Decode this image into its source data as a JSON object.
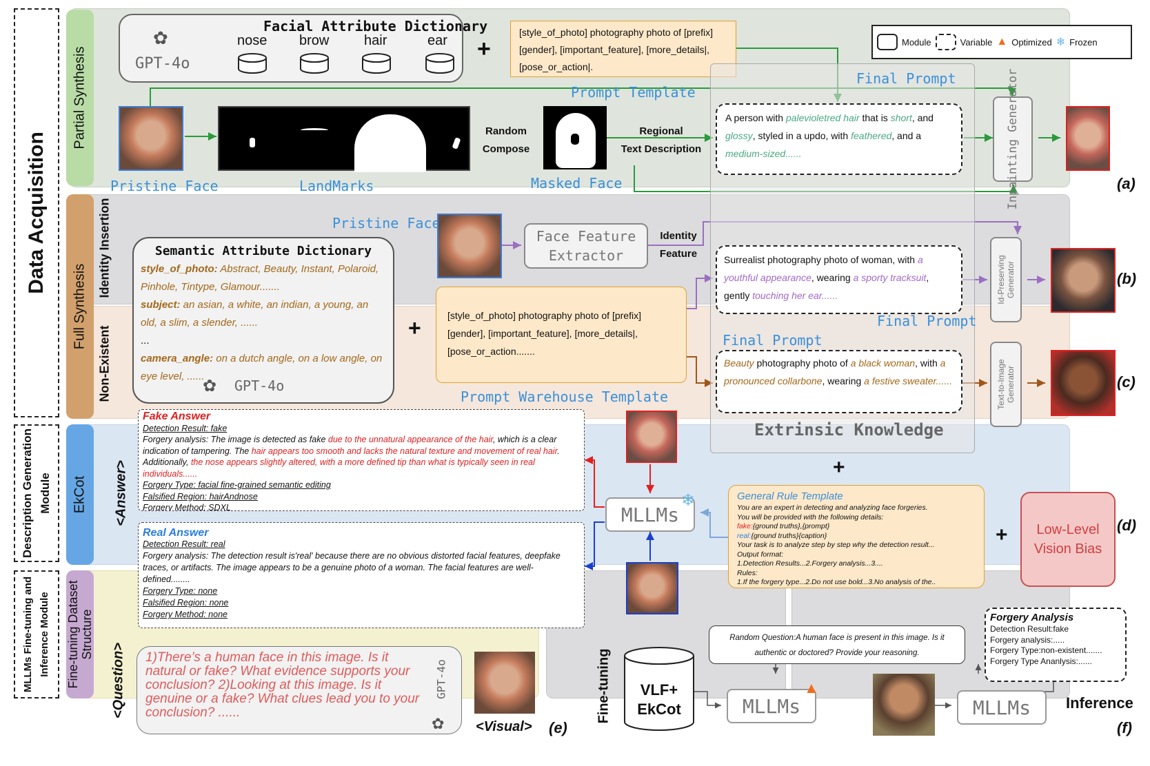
{
  "left": {
    "data_acquisition": "Data Acquisition",
    "description_module": "Description Generation Module",
    "finetune_module": "MLLMs Fine-tuning and Inference Module"
  },
  "rows": {
    "partial": "Partial Synthesis",
    "full": "Full Synthesis",
    "identity": "Identity Insertion",
    "nonexistent": "Non-Existent",
    "ekcot": "EkCot",
    "dataset": "Fine-tuning Dataset Structure"
  },
  "legend": {
    "module": "Module",
    "variable": "Variable",
    "optimized": "Optimized",
    "frozen": "Frozen"
  },
  "partial": {
    "dict_title": "Facial Attribute Dictionary",
    "gpt": "GPT-4o",
    "attrs": [
      "nose",
      "brow",
      "hair",
      "ear"
    ],
    "template": "[style_of_photo] photography photo of [prefix] [gender], [important_feature], [more_details|, [pose_or_action|.",
    "template_label": "Prompt Template",
    "final_prompt_label": "Final Prompt",
    "final_prompt": {
      "p1": "A person with ",
      "h1": "palevioletred hair",
      "p2": " that is ",
      "h2": "short",
      "p3": ", and ",
      "h3": "glossy",
      "p4": ", styled in a updo, with ",
      "h4": "feathered",
      "p5": ", and a ",
      "h5": "medium-sized......"
    },
    "pristine": "Pristine Face",
    "landmarks": "LandMarks",
    "random_compose_1": "Random",
    "random_compose_2": "Compose",
    "masked": "Masked Face",
    "regional_1": "Regional",
    "regional_2": "Text Description",
    "generator": "Inpainting Generator",
    "tag": "(a)"
  },
  "identity": {
    "pristine": "Pristine Face",
    "extractor_1": "Face Feature",
    "extractor_2": "Extractor",
    "feature_1": "Identity",
    "feature_2": "Feature",
    "final_prompt": {
      "p1": "Surrealist photography photo of woman, with ",
      "h1": "a youthful appearance",
      "p2": ", wearing ",
      "h2": "a sporty tracksuit",
      "p3": ", gently ",
      "h3": "touching her ear......"
    },
    "final_prompt_label": "Final Prompt",
    "generator": "Id-Preserving Generator",
    "tag": "(b)"
  },
  "semantic": {
    "title": "Semantic Attribute Dictionary",
    "k1": "style_of_photo:",
    "v1": " Abstract, Beauty, Instant, Polaroid, Pinhole, Tintype, Glamour.......",
    "k2": "subject:",
    "v2": " an asian, a white, an indian, a young, an old, a slim, a slender, ......",
    "ellipsis": "...",
    "k3": "camera_angle:",
    "v3": " on a dutch angle, on a low angle, on eye level, ......",
    "gpt": "GPT-4o"
  },
  "warehouse": {
    "text": "[style_of_photo] photography photo of [prefix] [gender], [important_feature], [more_details|, [pose_or_action.......",
    "label": "Prompt Warehouse Template"
  },
  "nonexistent": {
    "final_prompt_label": "Final Prompt",
    "final_prompt": {
      "h1": "Beauty",
      "p1": " photography photo of ",
      "h2": "a black woman",
      "p2": ", with ",
      "h3": "a pronounced collarbone",
      "p3": ", wearing ",
      "h4": "a festive sweater......"
    },
    "extrinsic": "Extrinsic Knowledge",
    "generator": "Text-to-Image Generator",
    "tag": "(c)"
  },
  "description": {
    "answer_tag": "<Answer>",
    "fake_title": "Fake Answer",
    "fake_result": "Detection Result: fake",
    "fake_a1": "Forgery analysis: The image is detected as fake ",
    "fake_r1": "due to the unnatural appearance of the hair",
    "fake_a2": ", which is a clear indication of tampering. The ",
    "fake_r2": "hair appears too smooth and lacks the natural texture and movement of real hair",
    "fake_a3": ". Additionally, ",
    "fake_r3": "the nose appears slightly altered, with a more defined tip than what is typically seen in real individuals......",
    "fake_type": "Forgery Type: facial fine-grained semantic editing",
    "fake_region": "Falsified Region: hairAndnose",
    "fake_method": "Forgery Method: SDXL",
    "real_title": "Real Answer",
    "real_result": "Detection Result: real",
    "real_analysis": "Forgery analysis: The detection result is'real' because there are no obvious distorted facial features, deepfake traces, or artifacts. The image appears to be a genuine photo of a woman. The facial features are well-defined........",
    "real_type": "Forgery Type: none",
    "real_region": "Falsified Region: none",
    "real_method": "Forgery Method: none",
    "mllms": "MLLMs",
    "rule_title": "General Rule Template",
    "rule_1": "You are an expert in detecting and analyzing face forgeries.",
    "rule_2": "You will be provided with the following details:",
    "rule_3k": "fake:",
    "rule_3v": "{ground truths},{prompt}",
    "rule_4k": "real:",
    "rule_4v": "{ground truths}{caption}",
    "rule_5": "Your task is to analyze step by step why the detection result...",
    "rule_6": "Output format:",
    "rule_7": "1.Detection Results...2.Forgery analysis...3....",
    "rule_8": "Rules:",
    "rule_9": "1.If the forgery type...2.Do not use bold...3.No analysis of the..",
    "bias_1": "Low-Level",
    "bias_2": "Vision Bias",
    "tag": "(d)"
  },
  "dataset": {
    "question_tag": "<Question>",
    "q": "1)There’s a human face in this image. Is it natural or fake? What evidence supports your conclusion? 2)Looking at this image. Is it genuine or a fake? What clues lead you to your conclusion? ......",
    "gpt": "GPT-4o",
    "visual": "<Visual>",
    "tag": "(e)"
  },
  "finetune": {
    "label": "Fine-tuning",
    "db_1": "VLF+",
    "db_2": "EkCot",
    "mllms": "MLLMs",
    "question": "Random Question:A human face is present in this image. Is it authentic or doctored? Provide your reasoning.",
    "analysis_title": "Forgery Analysis",
    "analysis_1": "Detection Result:fake",
    "analysis_2": "Forgery analysis:.....",
    "analysis_3": "Forgery Type:non-existent.......",
    "analysis_4": "Forgery Type Ananlysis:......",
    "inference": "Inference",
    "tag": "(f)"
  },
  "plus": "+",
  "colors": {
    "partial_bg": "#dfe5dc",
    "identity_bg": "#dcdcde",
    "nonexistent_bg": "#f5e7dc",
    "description_bg": "#dbe6f3",
    "dataset_bg": "#f4f1d0",
    "bottom_bg": "#dcdcde",
    "green_tab": "#b9dca6",
    "brown_tab": "#d2a06c",
    "blue_tab": "#66a6e4",
    "purple_tab": "#c6a9d1",
    "accent_blue": "#3a8fd9",
    "fake_red": "#e02020",
    "real_blue": "#2a7de0"
  }
}
